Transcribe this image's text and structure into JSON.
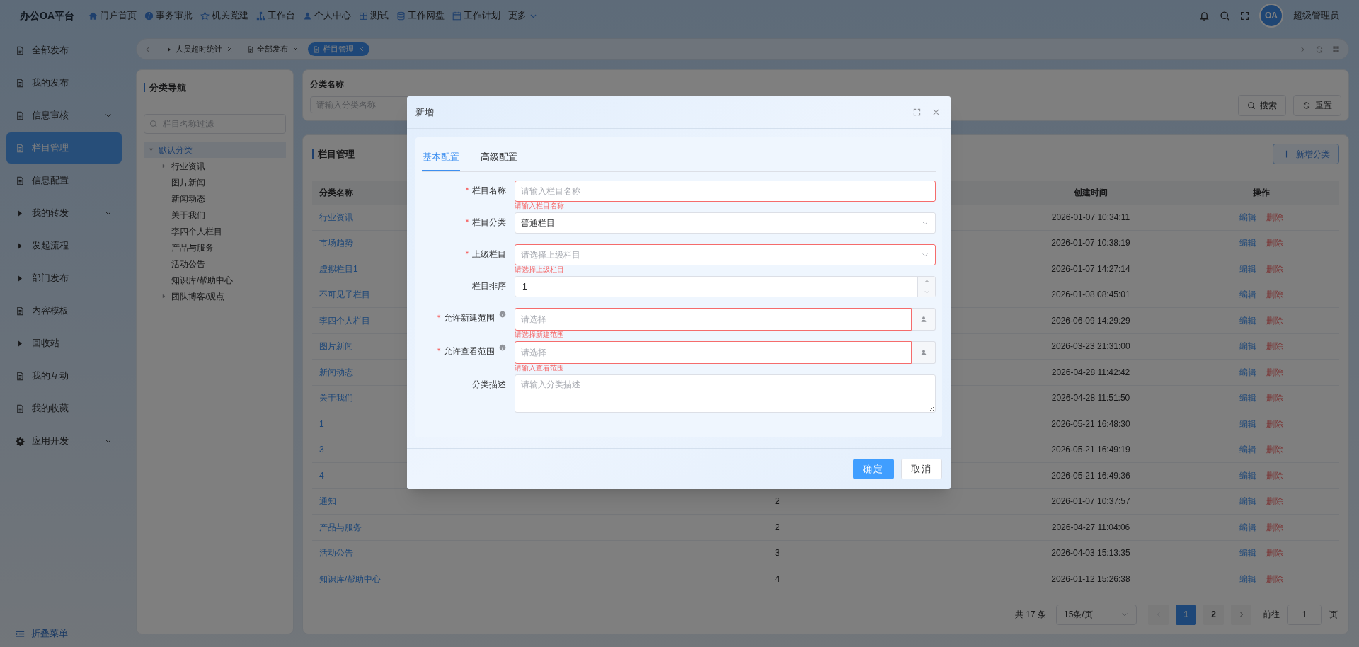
{
  "app": {
    "title": "办公OA平台"
  },
  "top_nav": [
    {
      "label": "门户首页",
      "dropdown": false
    },
    {
      "label": "事务审批",
      "dropdown": false
    },
    {
      "label": "机关党建",
      "dropdown": false
    },
    {
      "label": "工作台",
      "dropdown": false
    },
    {
      "label": "个人中心",
      "dropdown": false
    },
    {
      "label": "测试",
      "dropdown": false
    },
    {
      "label": "工作网盘",
      "dropdown": false
    },
    {
      "label": "工作计划",
      "dropdown": false
    },
    {
      "label": "更多",
      "dropdown": true
    }
  ],
  "user": {
    "avatar": "OA",
    "name": "超级管理员"
  },
  "sidebar": {
    "items": [
      {
        "label": "全部发布",
        "kind": "page",
        "expandable": false,
        "selected": false
      },
      {
        "label": "我的发布",
        "kind": "page",
        "expandable": false,
        "selected": false
      },
      {
        "label": "信息审核",
        "kind": "page",
        "expandable": true,
        "selected": false
      },
      {
        "label": "栏目管理",
        "kind": "page",
        "expandable": false,
        "selected": true
      },
      {
        "label": "信息配置",
        "kind": "page",
        "expandable": false,
        "selected": false
      },
      {
        "label": "我的转发",
        "kind": "group",
        "expandable": true,
        "selected": false
      },
      {
        "label": "发起流程",
        "kind": "group",
        "expandable": false,
        "selected": false
      },
      {
        "label": "部门发布",
        "kind": "group",
        "expandable": false,
        "selected": false
      },
      {
        "label": "内容模板",
        "kind": "page",
        "expandable": false,
        "selected": false
      },
      {
        "label": "回收站",
        "kind": "group",
        "expandable": false,
        "selected": false
      },
      {
        "label": "我的互动",
        "kind": "page",
        "expandable": false,
        "selected": false
      },
      {
        "label": "我的收藏",
        "kind": "page",
        "expandable": false,
        "selected": false
      },
      {
        "label": "应用开发",
        "kind": "settings",
        "expandable": true,
        "selected": false
      }
    ],
    "collapse": "折叠菜单"
  },
  "tabs": [
    {
      "label": "人员超时统计",
      "kind": "group",
      "selected": false
    },
    {
      "label": "全部发布",
      "kind": "page",
      "selected": false
    },
    {
      "label": "栏目管理",
      "kind": "page",
      "selected": true
    }
  ],
  "tree_panel": {
    "title": "分类导航",
    "filter_placeholder": "栏目名称过滤",
    "root": {
      "label": "默认分类",
      "expanded": true,
      "selected": true,
      "children": [
        {
          "label": "行业资讯",
          "has_children": true
        },
        {
          "label": "图片新闻",
          "has_children": false
        },
        {
          "label": "新闻动态",
          "has_children": false
        },
        {
          "label": "关于我们",
          "has_children": false
        },
        {
          "label": "李四个人栏目",
          "has_children": false
        },
        {
          "label": "产品与服务",
          "has_children": false
        },
        {
          "label": "活动公告",
          "has_children": false
        },
        {
          "label": "知识库/帮助中心",
          "has_children": false
        },
        {
          "label": "团队博客/观点",
          "has_children": true
        }
      ]
    }
  },
  "search": {
    "label": "分类名称",
    "placeholder": "请输入分类名称",
    "buttons": [
      "搜索",
      "重置"
    ]
  },
  "table_panel": {
    "title": "栏目管理",
    "add_button": "新增分类",
    "columns": {
      "name": "分类名称",
      "created": "创建时间",
      "actions": "操作"
    },
    "rows": [
      {
        "name": "行业资讯",
        "created": "2026-01-07 10:34:11",
        "actions": [
          {
            "label": "编辑",
            "kind": "edit"
          },
          {
            "label": "删除",
            "kind": "delete"
          }
        ]
      },
      {
        "name": "市场趋势",
        "created": "2026-01-07 10:38:19",
        "actions": [
          {
            "label": "编辑",
            "kind": "edit"
          },
          {
            "label": "删除",
            "kind": "delete"
          }
        ]
      },
      {
        "name": "虚拟栏目1",
        "created": "2026-01-07 14:27:14",
        "actions": [
          {
            "label": "编辑",
            "kind": "edit"
          },
          {
            "label": "删除",
            "kind": "delete"
          }
        ]
      },
      {
        "name": "不可见子栏目",
        "created": "2026-01-08 08:45:01",
        "actions": [
          {
            "label": "编辑",
            "kind": "edit"
          },
          {
            "label": "删除",
            "kind": "delete"
          }
        ]
      },
      {
        "name": "李四个人栏目",
        "created": "2026-06-09 14:29:29",
        "actions": [
          {
            "label": "编辑",
            "kind": "edit"
          },
          {
            "label": "删除",
            "kind": "delete"
          }
        ]
      },
      {
        "name": "图片新闻",
        "created": "2026-03-23 21:31:00",
        "actions": [
          {
            "label": "编辑",
            "kind": "edit"
          },
          {
            "label": "删除",
            "kind": "delete"
          }
        ]
      },
      {
        "name": "新闻动态",
        "created": "2026-04-28 11:42:42",
        "actions": [
          {
            "label": "编辑",
            "kind": "edit"
          },
          {
            "label": "删除",
            "kind": "delete"
          }
        ]
      },
      {
        "name": "关于我们",
        "created": "2026-04-28 11:51:50",
        "actions": [
          {
            "label": "编辑",
            "kind": "edit"
          },
          {
            "label": "删除",
            "kind": "delete"
          }
        ]
      },
      {
        "name": "1",
        "created": "2026-05-21 16:48:30",
        "actions": [
          {
            "label": "编辑",
            "kind": "edit"
          },
          {
            "label": "删除",
            "kind": "delete"
          }
        ]
      },
      {
        "name": "3",
        "created": "2026-05-21 16:49:19",
        "actions": [
          {
            "label": "编辑",
            "kind": "edit"
          },
          {
            "label": "删除",
            "kind": "delete"
          }
        ]
      },
      {
        "name": "4",
        "created": "2026-05-21 16:49:36",
        "actions": [
          {
            "label": "编辑",
            "kind": "edit"
          },
          {
            "label": "删除",
            "kind": "delete"
          }
        ]
      },
      {
        "name": "通知",
        "column_2": "2",
        "created": "2026-01-07 10:37:57",
        "actions": [
          {
            "label": "编辑",
            "kind": "edit"
          },
          {
            "label": "删除",
            "kind": "delete"
          }
        ]
      },
      {
        "name": "产品与服务",
        "column_2": "2",
        "created": "2026-04-27 11:04:06",
        "actions": [
          {
            "label": "编辑",
            "kind": "edit"
          },
          {
            "label": "删除",
            "kind": "delete"
          }
        ]
      },
      {
        "name": "活动公告",
        "column_2": "3",
        "created": "2026-04-03 15:13:35",
        "actions": [
          {
            "label": "编辑",
            "kind": "edit"
          },
          {
            "label": "删除",
            "kind": "delete"
          }
        ]
      },
      {
        "name": "知识库/帮助中心",
        "column_2": "4",
        "created": "2026-01-12 15:26:38",
        "actions": [
          {
            "label": "编辑",
            "kind": "edit"
          },
          {
            "label": "删除",
            "kind": "delete"
          }
        ]
      }
    ],
    "pagination": {
      "total": "共 17 条",
      "page_size": "15条/页",
      "pages": [
        {
          "label": "1",
          "selected": true
        },
        {
          "label": "2",
          "selected": false
        }
      ],
      "goto_label": "前往",
      "goto_value": "1",
      "unit": "页"
    }
  },
  "dialog": {
    "title": "新增",
    "tabs": [
      {
        "label": "基本配置",
        "selected": true
      },
      {
        "label": "高级配置",
        "selected": false
      }
    ],
    "fields": [
      {
        "kind": "text",
        "label": "栏目名称",
        "required": true,
        "info": false,
        "placeholder": "请输入栏目名称",
        "error": "请输入栏目名称"
      },
      {
        "kind": "select",
        "label": "栏目分类",
        "required": true,
        "info": false,
        "value": "普通栏目"
      },
      {
        "kind": "select",
        "label": "上级栏目",
        "required": true,
        "info": false,
        "placeholder": "请选择上级栏目",
        "error": "请选择上级栏目"
      },
      {
        "kind": "number",
        "label": "栏目排序",
        "required": false,
        "info": false,
        "value": "1"
      },
      {
        "kind": "picker",
        "label": "允许新建范围",
        "required": true,
        "info": true,
        "placeholder": "请选择",
        "error": "请选择新建范围"
      },
      {
        "kind": "picker",
        "label": "允许查看范围",
        "required": true,
        "info": true,
        "placeholder": "请选择",
        "error": "请输入查看范围"
      },
      {
        "kind": "textarea",
        "label": "分类描述",
        "required": false,
        "info": false,
        "placeholder": "请输入分类描述"
      }
    ],
    "buttons": [
      {
        "label": "确定",
        "kind": "primary"
      },
      {
        "label": "取消",
        "kind": "default"
      }
    ]
  }
}
